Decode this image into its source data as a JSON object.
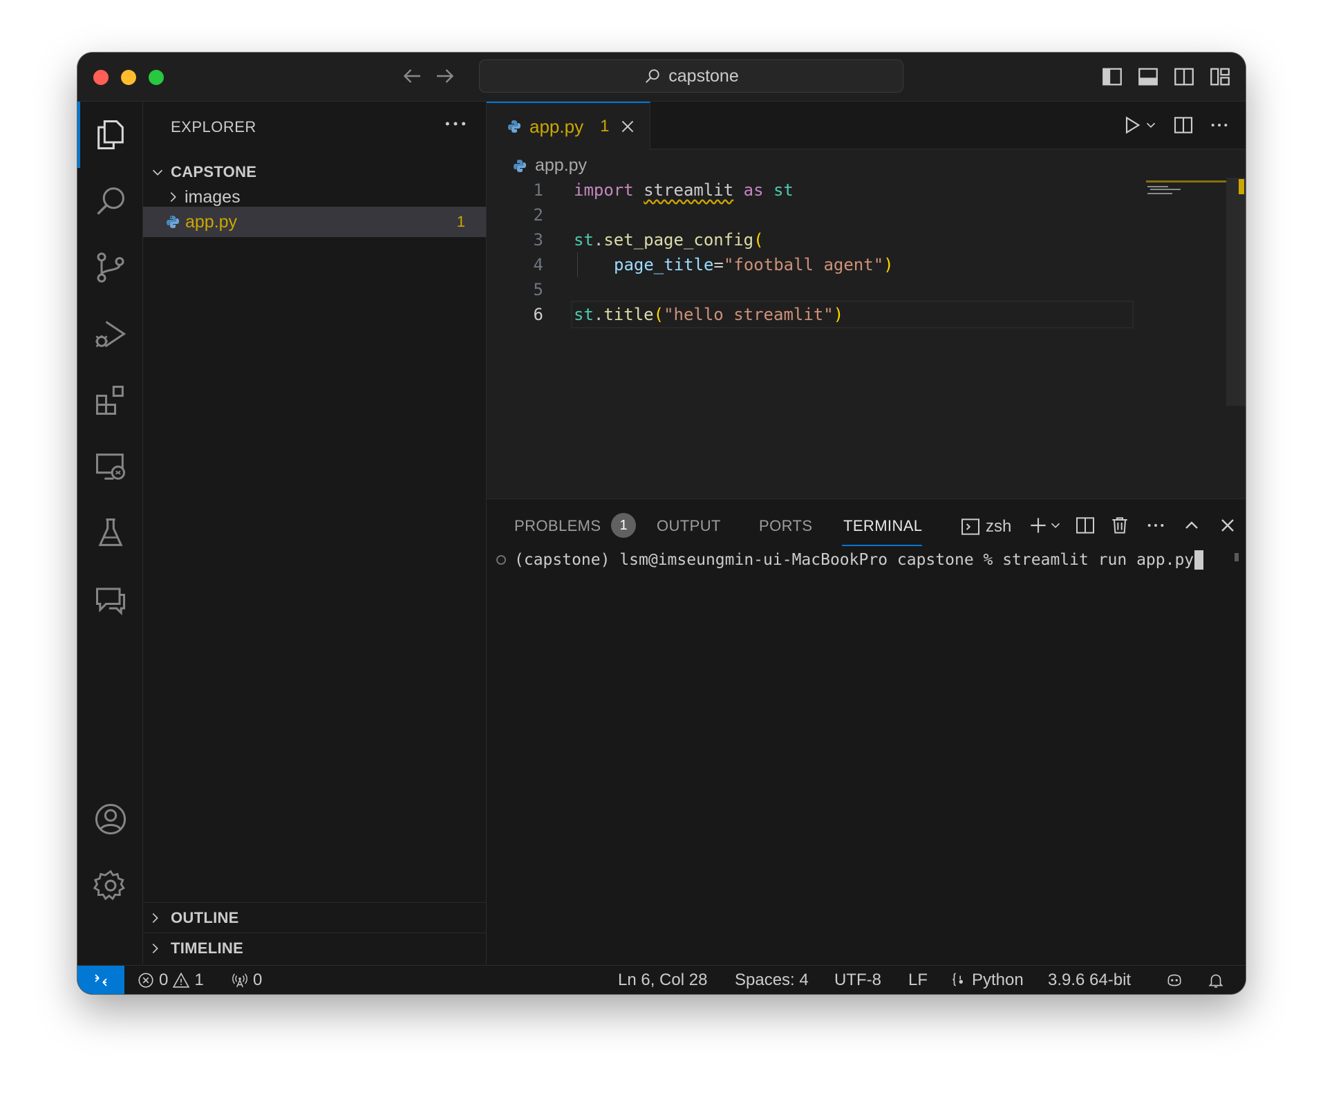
{
  "window": {
    "search": "capstone"
  },
  "sidebar": {
    "title": "EXPLORER",
    "folder": "CAPSTONE",
    "items": [
      {
        "label": "images",
        "type": "folder"
      },
      {
        "label": "app.py",
        "type": "file",
        "badge": "1",
        "selected": true
      }
    ],
    "sections": [
      "OUTLINE",
      "TIMELINE"
    ]
  },
  "editor": {
    "tab": {
      "label": "app.py",
      "badge": "1"
    },
    "breadcrumb": "app.py",
    "line_numbers": [
      "1",
      "2",
      "3",
      "4",
      "5",
      "6"
    ],
    "code": {
      "l1": {
        "import": "import",
        "module": "streamlit",
        "as": "as",
        "alias": "st"
      },
      "l3": {
        "obj": "st",
        "dot": ".",
        "fn": "set_page_config",
        "open": "("
      },
      "l4": {
        "param": "page_title",
        "eq": "=",
        "value": "\"football agent\"",
        "close": ")"
      },
      "l6": {
        "obj": "st",
        "dot": ".",
        "fn": "title",
        "open": "(",
        "value": "\"hello streamlit\"",
        "close": ")"
      }
    }
  },
  "panel": {
    "tabs": [
      "PROBLEMS",
      "OUTPUT",
      "PORTS",
      "TERMINAL"
    ],
    "problems_count": "1",
    "active_tab": "TERMINAL",
    "shell": "zsh",
    "terminal_line": "(capstone) lsm@imseungmin-ui-MacBookPro capstone % streamlit run app.py"
  },
  "status": {
    "errors": "0",
    "warnings": "1",
    "ports": "0",
    "position": "Ln 6, Col 28",
    "spaces": "Spaces: 4",
    "encoding": "UTF-8",
    "eol": "LF",
    "language": "Python",
    "interpreter": "3.9.6 64-bit"
  },
  "colors": {
    "accent": "#0078d4",
    "warning": "#cca700",
    "background": "#181818",
    "editor_background": "#1f1f1f"
  },
  "icons": {
    "activity": [
      "explorer-icon",
      "search-icon",
      "source-control-icon",
      "run-debug-icon",
      "extensions-icon",
      "remote-explorer-icon",
      "testing-icon",
      "chat-icon",
      "accounts-icon",
      "manage-gear-icon"
    ]
  }
}
